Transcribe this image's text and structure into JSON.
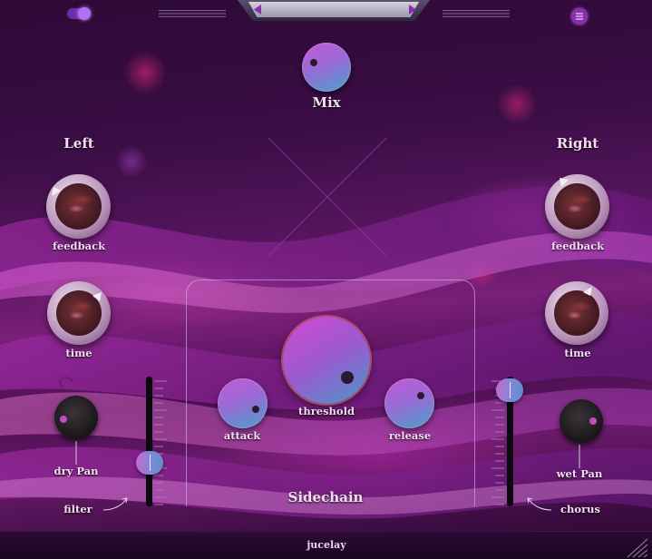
{
  "window": {
    "background": "#2d0936",
    "accent": "#c45ad8",
    "brand": "jucelay"
  },
  "top_bar": {
    "bypass_toggle": {
      "on": true,
      "icon": "toggle-switch-icon"
    },
    "preset_prev_icon": "arrow-left-icon",
    "preset_next_icon": "arrow-right-icon",
    "menu_icon": "menu-icon"
  },
  "mix": {
    "label": "Mix"
  },
  "left": {
    "title": "Left",
    "feedback_label": "feedback",
    "time_label": "time",
    "dry_pan_label": "dry Pan",
    "filter_label": "filter"
  },
  "right": {
    "title": "Right",
    "feedback_label": "feedback",
    "time_label": "time",
    "wet_pan_label": "wet Pan",
    "chorus_label": "chorus"
  },
  "sidechain": {
    "title": "Sidechain",
    "threshold_label": "threshold",
    "attack_label": "attack",
    "release_label": "release"
  },
  "footer": {
    "brand": "jucelay"
  }
}
